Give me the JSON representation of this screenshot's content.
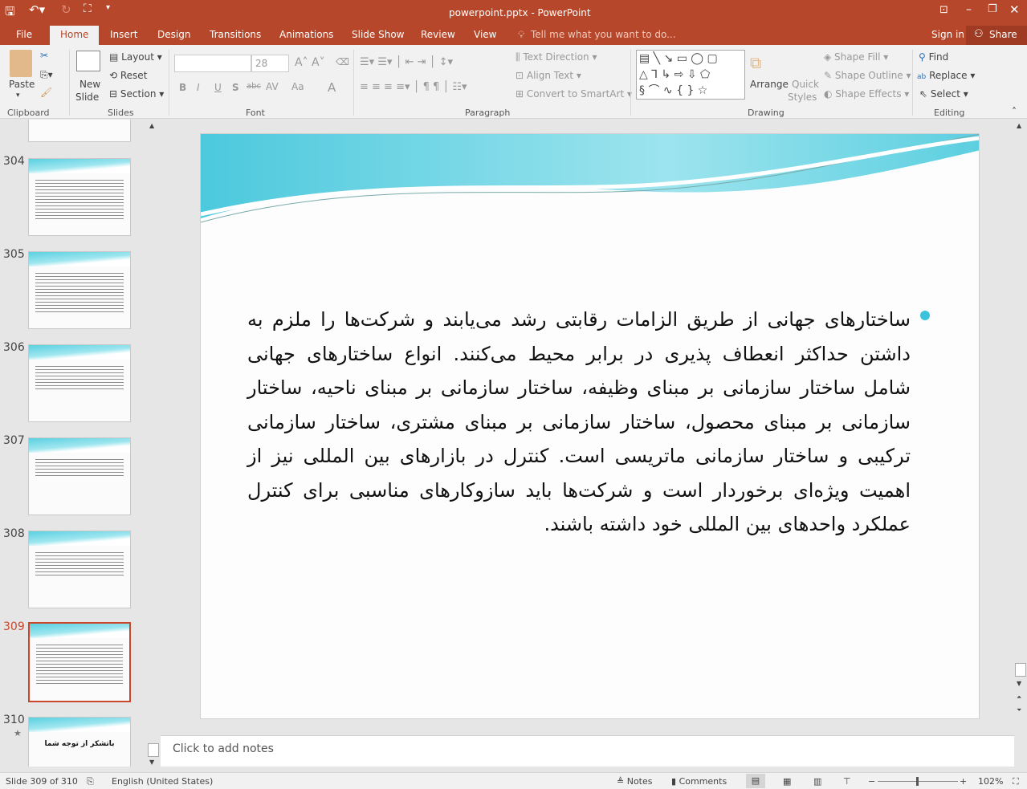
{
  "window": {
    "title": "powerpoint.pptx - PowerPoint",
    "quick_access": [
      "save-icon",
      "undo-icon",
      "redo-icon",
      "start-from-beginning-icon",
      "customize-icon"
    ],
    "controls": [
      "ribbon-display-icon",
      "minimize-icon",
      "restore-icon",
      "close-icon"
    ]
  },
  "tabs": [
    "File",
    "Home",
    "Insert",
    "Design",
    "Transitions",
    "Animations",
    "Slide Show",
    "Review",
    "View"
  ],
  "active_tab": "Home",
  "tell_me": "Tell me what you want to do...",
  "sign_in": "Sign in",
  "share": "Share",
  "ribbon": {
    "clipboard": {
      "label": "Clipboard",
      "paste": "Paste"
    },
    "slides": {
      "label": "Slides",
      "new_slide": "New",
      "new_slide2": "Slide",
      "layout": "Layout",
      "reset": "Reset",
      "section": "Section"
    },
    "font": {
      "label": "Font",
      "font_name": "",
      "font_size": "28",
      "bold": "B",
      "italic": "I",
      "underline": "U",
      "shadow": "S",
      "strike": "abc",
      "spacing": "AV",
      "case": "Aa",
      "color": "A"
    },
    "paragraph": {
      "label": "Paragraph",
      "text_direction": "Text Direction",
      "align_text": "Align Text",
      "smartart": "Convert to SmartArt"
    },
    "drawing": {
      "label": "Drawing",
      "arrange": "Arrange",
      "quick": "Quick",
      "styles": "Styles",
      "shape_fill": "Shape Fill",
      "shape_outline": "Shape Outline",
      "shape_effects": "Shape Effects"
    },
    "editing": {
      "label": "Editing",
      "find": "Find",
      "replace": "Replace",
      "select": "Select"
    }
  },
  "thumbnails": [
    {
      "number": "304"
    },
    {
      "number": "305"
    },
    {
      "number": "306"
    },
    {
      "number": "307"
    },
    {
      "number": "308"
    },
    {
      "number": "309",
      "selected": true
    },
    {
      "number": "310",
      "text": "باتشکر از توجه شما"
    }
  ],
  "slide": {
    "body": "ساختارهای جهانی از طریق الزامات رقابتی رشد می‌یابند و شرکت‌ها را ملزم به داشتن حداکثر انعطاف پذیری در برابر محیط می‌کنند. انواع ساختارهای جهانی شامل ساختار سازمانی بر مبنای وظیفه، ساختار سازمانی بر مبنای ناحیه، ساختار سازمانی بر مبنای محصول، ساختار سازمانی بر مبنای مشتری، ساختار سازمانی ترکیبی و ساختار سازمانی ماتریسی است. کنترل در بازارهای بین المللی نیز از اهمیت ویژه‌ای برخوردار است و شرکت‌ها باید سازوکارهای مناسبی برای کنترل عملکرد واحدهای بین المللی خود داشته باشند."
  },
  "notes_placeholder": "Click to add notes",
  "status": {
    "slide": "Slide 309 of 310",
    "language": "English (United States)",
    "notes": "Notes",
    "comments": "Comments",
    "zoom": "102%"
  },
  "colors": {
    "accent": "#b7472a",
    "bullet": "#3cc3dc"
  }
}
